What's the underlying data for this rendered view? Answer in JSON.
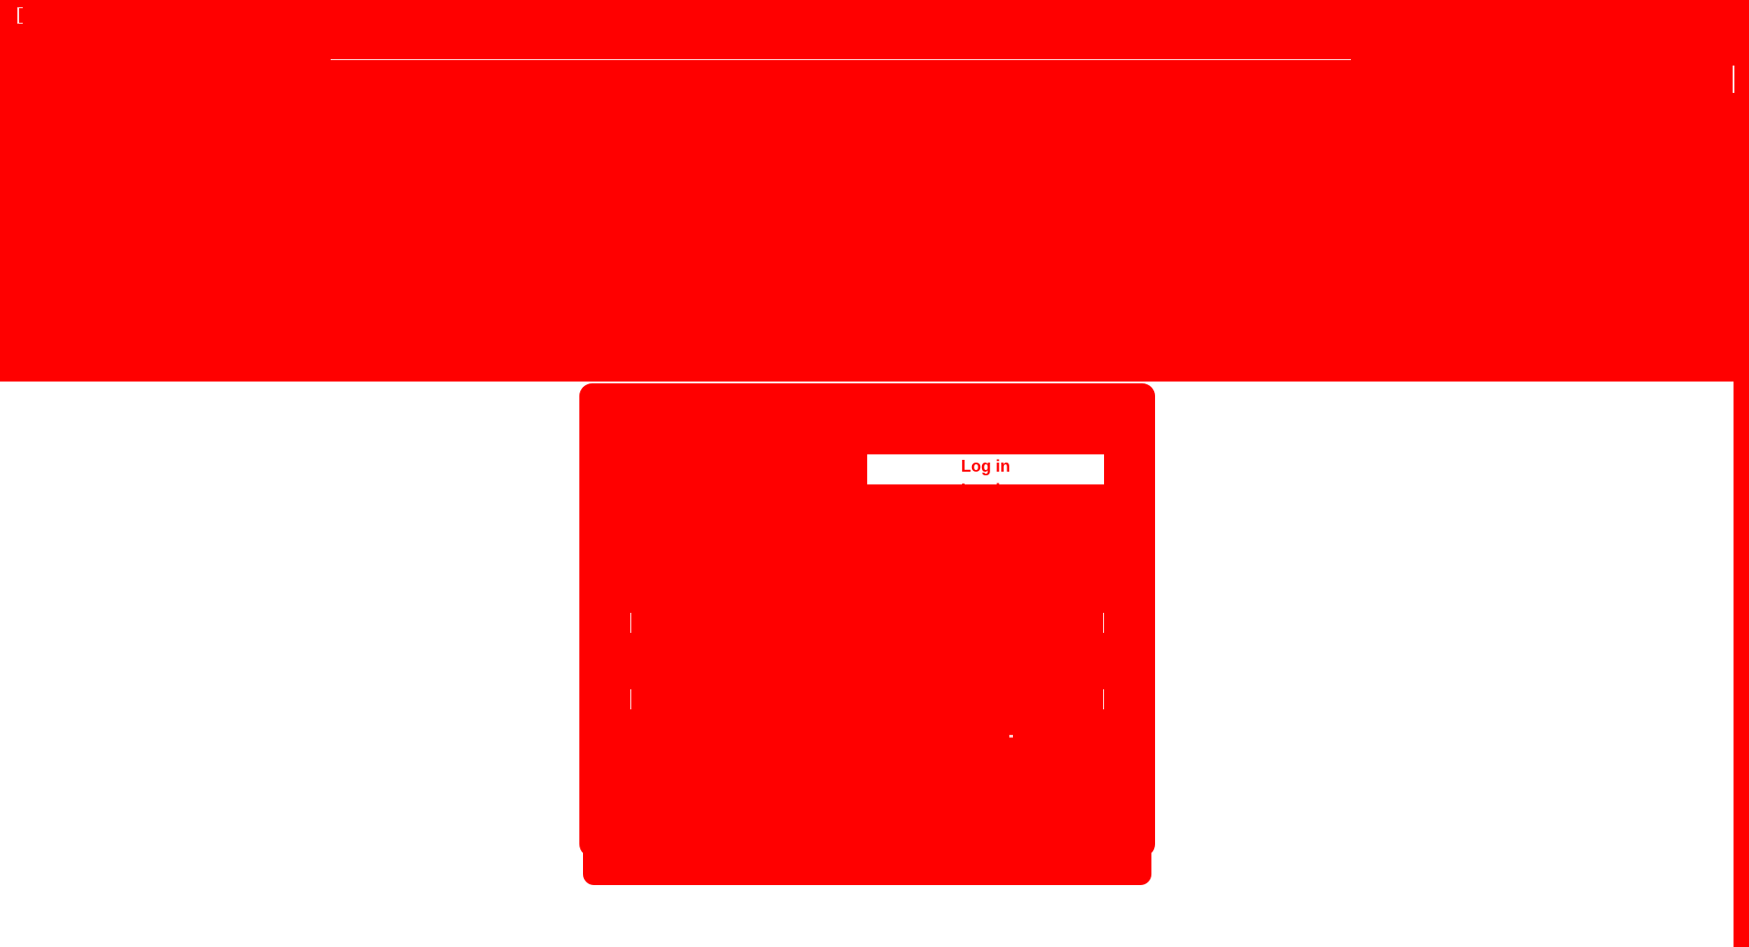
{
  "header": {
    "title": "",
    "subtitle": ""
  },
  "login_card": {
    "tab_label": "Log in",
    "tab_label_secondary": "Log in",
    "email_value": "",
    "password_value": ""
  },
  "colors": {
    "primary": "#ff0000",
    "surface": "#ffffff"
  }
}
